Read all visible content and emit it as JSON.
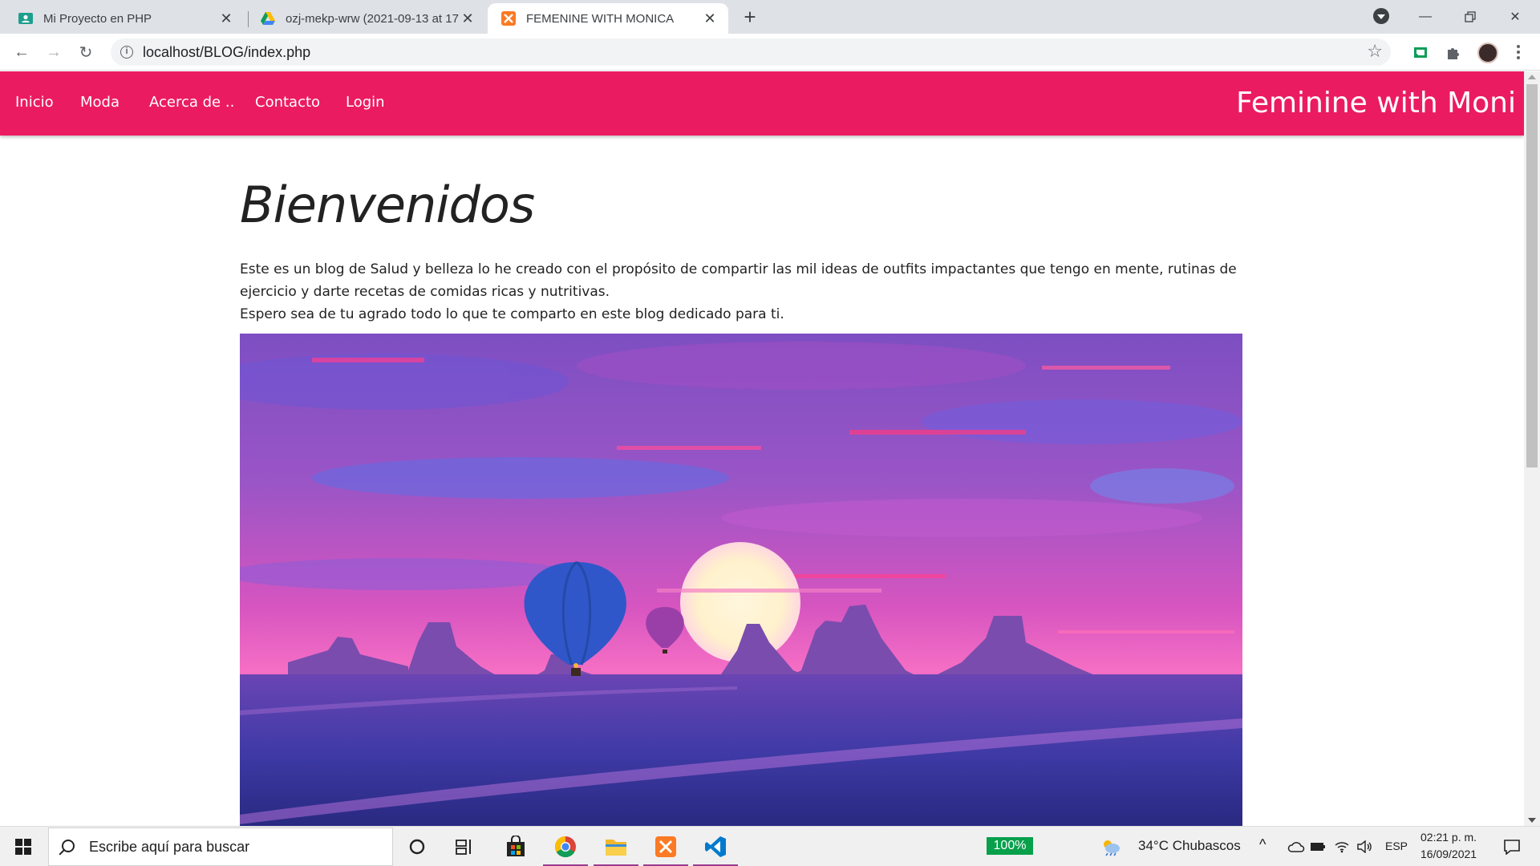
{
  "browser": {
    "tabs": [
      {
        "title": "Mi Proyecto en PHP",
        "icon": "classroom-icon"
      },
      {
        "title": "ozj-mekp-wrw (2021-09-13 at 17",
        "icon": "google-drive-icon"
      },
      {
        "title": "FEMENINE WITH MONICA",
        "icon": "xampp-icon"
      }
    ],
    "url": "localhost/BLOG/index.php"
  },
  "site": {
    "nav": [
      "Inicio",
      "Moda",
      "Acerca de ..",
      "Contacto",
      "Login"
    ],
    "brand": "Feminine with Moni",
    "accent_color": "#eb1b62"
  },
  "content": {
    "heading": "Bienvenidos",
    "paragraph_1": "Este es un blog de Salud y belleza lo he creado con el propósito de compartir las mil ideas de outfits impactantes que tengo en mente, rutinas de ejercicio y darte recetas de comidas ricas y nutritivas.",
    "paragraph_2": "Espero sea de tu agrado todo lo que te comparto en este blog dedicado para ti.",
    "hero_image": "sunset-desert-hot-air-balloons"
  },
  "taskbar": {
    "search_placeholder": "Escribe aquí para buscar",
    "battery": "100%",
    "weather": "34°C  Chubascos",
    "language": "ESP",
    "time": "02:21 p. m.",
    "date": "16/09/2021"
  }
}
